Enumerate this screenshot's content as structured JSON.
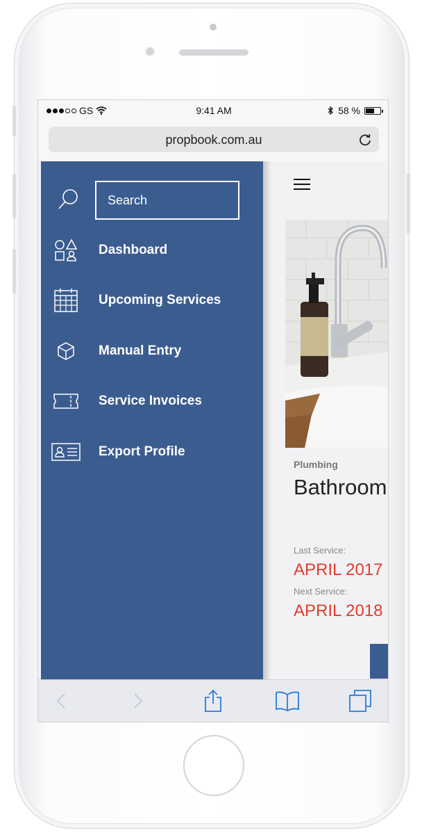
{
  "statusbar": {
    "carrier": "GS",
    "time": "9:41 AM",
    "battery": "58 %"
  },
  "browser": {
    "url": "propbook.com.au"
  },
  "drawer": {
    "search_placeholder": "Search",
    "items": [
      {
        "label": "Dashboard",
        "icon": "shapes-icon"
      },
      {
        "label": "Upcoming Services",
        "icon": "calendar-icon"
      },
      {
        "label": "Manual Entry",
        "icon": "box-icon"
      },
      {
        "label": "Service Invoices",
        "icon": "ticket-icon"
      },
      {
        "label": "Export Profile",
        "icon": "id-card-icon"
      }
    ]
  },
  "main": {
    "category": "Plumbing",
    "title": "Bathroom",
    "last_service_label": "Last Service:",
    "last_service": "APRIL 2017",
    "next_service_label": "Next Service:",
    "next_service": "APRIL 2018"
  },
  "colors": {
    "drawer": "#3b5c8f",
    "accent_red": "#e23b2b",
    "safari_blue": "#2b7cd3"
  }
}
